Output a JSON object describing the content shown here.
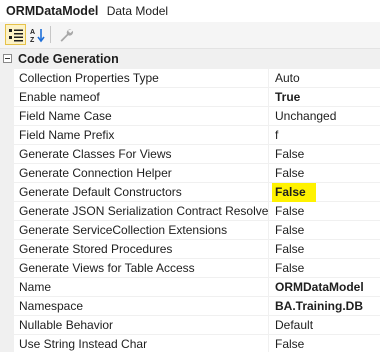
{
  "header": {
    "object_name": "ORMDataModel",
    "object_type": "Data Model"
  },
  "toolbar": {
    "buttons": [
      {
        "name": "categorized-view-button",
        "icon": "categorized-icon",
        "active": true
      },
      {
        "name": "alphabetical-sort-button",
        "icon": "sort-az-icon",
        "active": false
      },
      {
        "name": "property-pages-button",
        "icon": "wrench-icon",
        "active": false
      }
    ]
  },
  "category": {
    "label": "Code Generation",
    "expanded": true
  },
  "properties": [
    {
      "name": "Collection Properties Type",
      "value": "Auto",
      "bold": false,
      "highlight": false
    },
    {
      "name": "Enable nameof",
      "value": "True",
      "bold": true,
      "highlight": false
    },
    {
      "name": "Field Name Case",
      "value": "Unchanged",
      "bold": false,
      "highlight": false
    },
    {
      "name": "Field Name Prefix",
      "value": "f",
      "bold": false,
      "highlight": false
    },
    {
      "name": "Generate Classes For Views",
      "value": "False",
      "bold": false,
      "highlight": false
    },
    {
      "name": "Generate Connection Helper",
      "value": "False",
      "bold": false,
      "highlight": false
    },
    {
      "name": "Generate Default Constructors",
      "value": "False",
      "bold": true,
      "highlight": true
    },
    {
      "name": "Generate JSON Serialization Contract Resolver",
      "value": "False",
      "bold": false,
      "highlight": false
    },
    {
      "name": "Generate ServiceCollection Extensions",
      "value": "False",
      "bold": false,
      "highlight": false
    },
    {
      "name": "Generate Stored Procedures",
      "value": "False",
      "bold": false,
      "highlight": false
    },
    {
      "name": "Generate Views for Table Access",
      "value": "False",
      "bold": false,
      "highlight": false
    },
    {
      "name": "Name",
      "value": "ORMDataModel",
      "bold": true,
      "highlight": false
    },
    {
      "name": "Namespace",
      "value": "BA.Training.DB",
      "bold": true,
      "highlight": false
    },
    {
      "name": "Nullable Behavior",
      "value": "Default",
      "bold": false,
      "highlight": false
    },
    {
      "name": "Use String Instead Char",
      "value": "False",
      "bold": false,
      "highlight": false
    }
  ],
  "colors": {
    "highlight": "#fff200",
    "toolbar_active_bg": "#fcf2c6",
    "gutter": "#f0f0f0"
  }
}
